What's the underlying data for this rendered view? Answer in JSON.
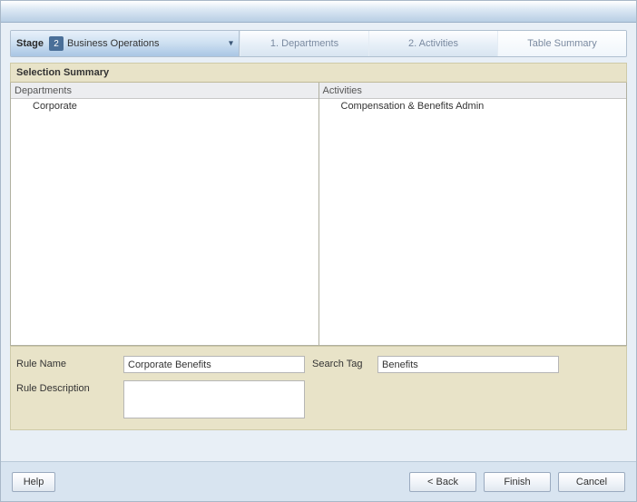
{
  "stage": {
    "label": "Stage",
    "number": "2",
    "value": "Business Operations"
  },
  "tabs": [
    {
      "label": "1. Departments"
    },
    {
      "label": "2. Activities"
    },
    {
      "label": "Table Summary"
    }
  ],
  "section_title": "Selection Summary",
  "columns": {
    "departments": {
      "header": "Departments",
      "items": [
        "Corporate"
      ]
    },
    "activities": {
      "header": "Activities",
      "items": [
        "Compensation & Benefits Admin"
      ]
    }
  },
  "form": {
    "rule_name_label": "Rule Name",
    "rule_name_value": "Corporate Benefits",
    "search_tag_label": "Search Tag",
    "search_tag_value": "Benefits",
    "rule_desc_label": "Rule Description",
    "rule_desc_value": ""
  },
  "buttons": {
    "help": "Help",
    "back": "< Back",
    "finish": "Finish",
    "cancel": "Cancel"
  }
}
